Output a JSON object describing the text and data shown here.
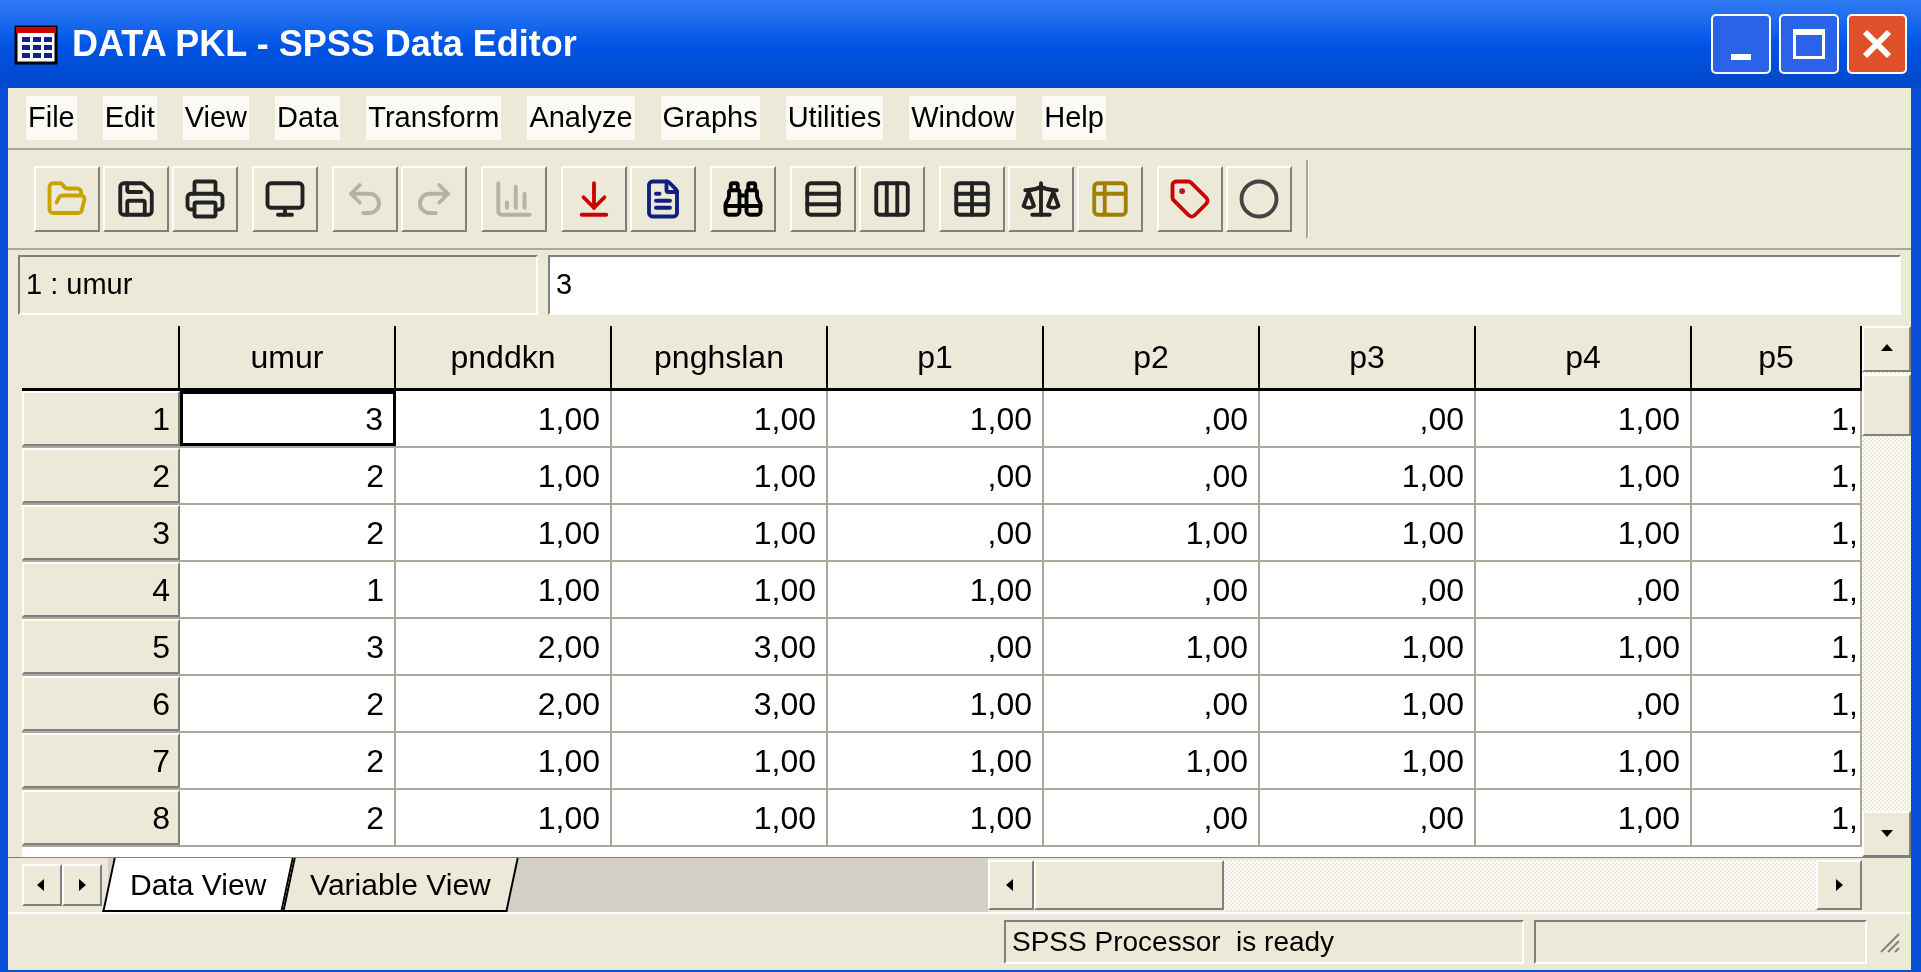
{
  "window": {
    "title": "DATA PKL - SPSS Data Editor"
  },
  "menu": [
    "File",
    "Edit",
    "View",
    "Data",
    "Transform",
    "Analyze",
    "Graphs",
    "Utilities",
    "Window",
    "Help"
  ],
  "toolbar": {
    "groups": [
      {
        "buttons": [
          {
            "kind": "open",
            "disabled": false
          },
          {
            "kind": "save",
            "disabled": false
          },
          {
            "kind": "print",
            "disabled": false
          }
        ]
      },
      {
        "buttons": [
          {
            "kind": "dialog",
            "disabled": false
          }
        ]
      },
      {
        "buttons": [
          {
            "kind": "undo",
            "disabled": true
          },
          {
            "kind": "redo",
            "disabled": true
          }
        ]
      },
      {
        "buttons": [
          {
            "kind": "chart",
            "disabled": true
          }
        ]
      },
      {
        "buttons": [
          {
            "kind": "goto",
            "disabled": false
          },
          {
            "kind": "variables",
            "disabled": false
          }
        ]
      },
      {
        "buttons": [
          {
            "kind": "find",
            "disabled": false
          }
        ]
      },
      {
        "buttons": [
          {
            "kind": "insert_case",
            "disabled": false
          },
          {
            "kind": "insert_variable",
            "disabled": false
          }
        ]
      },
      {
        "buttons": [
          {
            "kind": "split",
            "disabled": false
          },
          {
            "kind": "weight",
            "disabled": false
          },
          {
            "kind": "select",
            "disabled": false
          }
        ]
      },
      {
        "buttons": [
          {
            "kind": "labels",
            "disabled": false
          },
          {
            "kind": "sets",
            "disabled": false
          }
        ]
      }
    ]
  },
  "cell_editor": {
    "cell": "1 : umur",
    "value": "3"
  },
  "grid": {
    "columns": [
      "umur",
      "pnddkn",
      "pnghslan",
      "p1",
      "p2",
      "p3",
      "p4",
      "p5"
    ],
    "rows": [
      {
        "number": "1",
        "cells": [
          {
            "value": "3",
            "selected": true
          },
          {
            "value": "1,00",
            "selected": false
          },
          {
            "value": "1,00",
            "selected": false
          },
          {
            "value": "1,00",
            "selected": false
          },
          {
            "value": ",00",
            "selected": false
          },
          {
            "value": ",00",
            "selected": false
          },
          {
            "value": "1,00",
            "selected": false
          },
          {
            "value": "1,",
            "selected": false
          }
        ]
      },
      {
        "number": "2",
        "cells": [
          {
            "value": "2",
            "selected": false
          },
          {
            "value": "1,00",
            "selected": false
          },
          {
            "value": "1,00",
            "selected": false
          },
          {
            "value": ",00",
            "selected": false
          },
          {
            "value": ",00",
            "selected": false
          },
          {
            "value": "1,00",
            "selected": false
          },
          {
            "value": "1,00",
            "selected": false
          },
          {
            "value": "1,",
            "selected": false
          }
        ]
      },
      {
        "number": "3",
        "cells": [
          {
            "value": "2",
            "selected": false
          },
          {
            "value": "1,00",
            "selected": false
          },
          {
            "value": "1,00",
            "selected": false
          },
          {
            "value": ",00",
            "selected": false
          },
          {
            "value": "1,00",
            "selected": false
          },
          {
            "value": "1,00",
            "selected": false
          },
          {
            "value": "1,00",
            "selected": false
          },
          {
            "value": "1,",
            "selected": false
          }
        ]
      },
      {
        "number": "4",
        "cells": [
          {
            "value": "1",
            "selected": false
          },
          {
            "value": "1,00",
            "selected": false
          },
          {
            "value": "1,00",
            "selected": false
          },
          {
            "value": "1,00",
            "selected": false
          },
          {
            "value": ",00",
            "selected": false
          },
          {
            "value": ",00",
            "selected": false
          },
          {
            "value": ",00",
            "selected": false
          },
          {
            "value": "1,",
            "selected": false
          }
        ]
      },
      {
        "number": "5",
        "cells": [
          {
            "value": "3",
            "selected": false
          },
          {
            "value": "2,00",
            "selected": false
          },
          {
            "value": "3,00",
            "selected": false
          },
          {
            "value": ",00",
            "selected": false
          },
          {
            "value": "1,00",
            "selected": false
          },
          {
            "value": "1,00",
            "selected": false
          },
          {
            "value": "1,00",
            "selected": false
          },
          {
            "value": "1,",
            "selected": false
          }
        ]
      },
      {
        "number": "6",
        "cells": [
          {
            "value": "2",
            "selected": false
          },
          {
            "value": "2,00",
            "selected": false
          },
          {
            "value": "3,00",
            "selected": false
          },
          {
            "value": "1,00",
            "selected": false
          },
          {
            "value": ",00",
            "selected": false
          },
          {
            "value": "1,00",
            "selected": false
          },
          {
            "value": ",00",
            "selected": false
          },
          {
            "value": "1,",
            "selected": false
          }
        ]
      },
      {
        "number": "7",
        "cells": [
          {
            "value": "2",
            "selected": false
          },
          {
            "value": "1,00",
            "selected": false
          },
          {
            "value": "1,00",
            "selected": false
          },
          {
            "value": "1,00",
            "selected": false
          },
          {
            "value": "1,00",
            "selected": false
          },
          {
            "value": "1,00",
            "selected": false
          },
          {
            "value": "1,00",
            "selected": false
          },
          {
            "value": "1,",
            "selected": false
          }
        ]
      },
      {
        "number": "8",
        "cells": [
          {
            "value": "2",
            "selected": false
          },
          {
            "value": "1,00",
            "selected": false
          },
          {
            "value": "1,00",
            "selected": false
          },
          {
            "value": "1,00",
            "selected": false
          },
          {
            "value": ",00",
            "selected": false
          },
          {
            "value": ",00",
            "selected": false
          },
          {
            "value": "1,00",
            "selected": false
          },
          {
            "value": "1,",
            "selected": false
          }
        ]
      }
    ]
  },
  "tabs": [
    {
      "label": "Data View",
      "selected": true
    },
    {
      "label": "Variable View",
      "selected": false
    }
  ],
  "status_bar": {
    "message": "SPSS Processor  is ready"
  }
}
